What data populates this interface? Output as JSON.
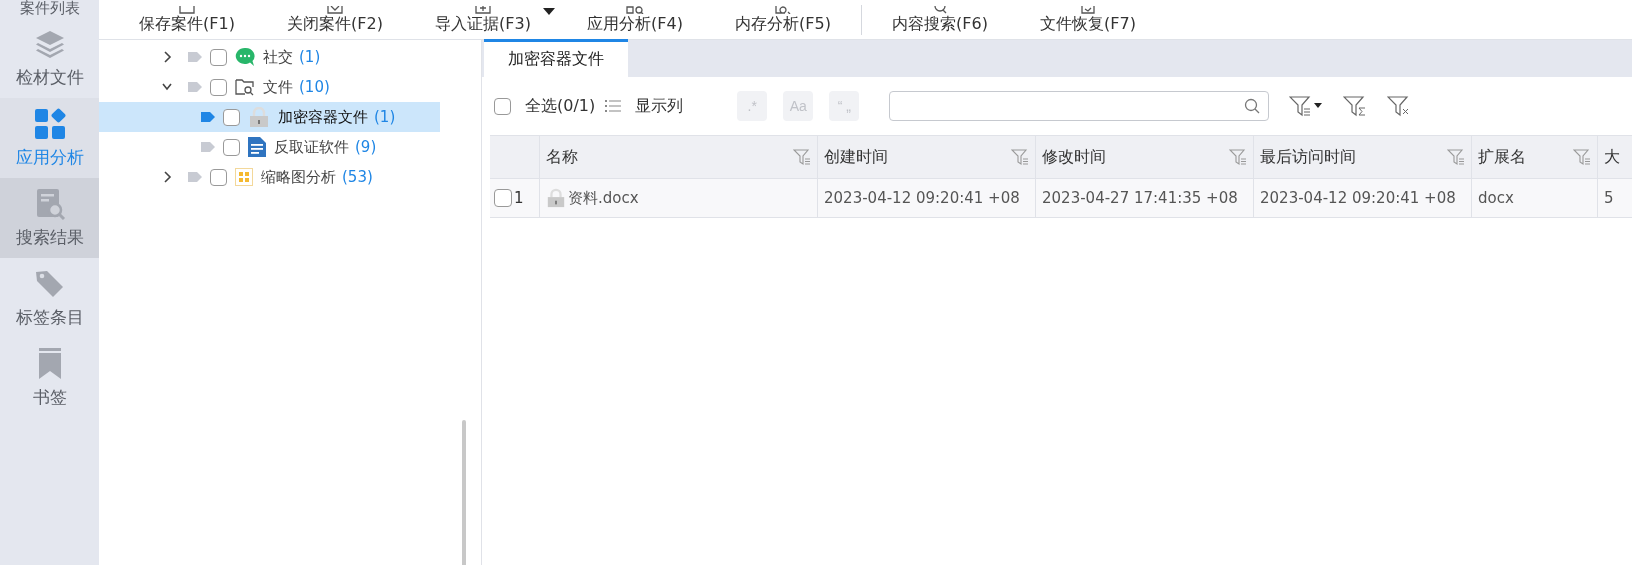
{
  "sidebar": {
    "items": [
      {
        "label": "案件列表",
        "selected": false,
        "hovered": false
      },
      {
        "label": "检材文件",
        "selected": false,
        "hovered": false
      },
      {
        "label": "应用分析",
        "selected": true,
        "hovered": false
      },
      {
        "label": "搜索结果",
        "selected": false,
        "hovered": true
      },
      {
        "label": "标签条目",
        "selected": false,
        "hovered": false
      },
      {
        "label": "书签",
        "selected": false,
        "hovered": false
      }
    ]
  },
  "toolbar": {
    "buttons": [
      {
        "label": "保存案件(F1)",
        "kind": "button"
      },
      {
        "label": "关闭案件(F2)",
        "kind": "button"
      },
      {
        "label": "导入证据(F3)",
        "kind": "button"
      },
      {
        "kind": "dropdown"
      },
      {
        "label": "应用分析(F4)",
        "kind": "button"
      },
      {
        "label": "内存分析(F5)",
        "kind": "button"
      },
      {
        "kind": "separator"
      },
      {
        "label": "内容搜索(F6)",
        "kind": "button"
      },
      {
        "label": "文件恢复(F7)",
        "kind": "button"
      }
    ]
  },
  "tree": [
    {
      "label": "社交",
      "count": "(1)",
      "kind": "chat",
      "expanded": false,
      "checked": false,
      "selected": false
    },
    {
      "label": "文件",
      "count": "(10)",
      "kind": "folder-search",
      "expanded": true,
      "checked": false,
      "selected": false,
      "children": [
        {
          "label": "加密容器文件",
          "count": "(1)",
          "kind": "lock",
          "checked": false,
          "selected": true
        },
        {
          "label": "反取证软件",
          "count": "(9)",
          "kind": "document",
          "checked": false,
          "selected": false
        }
      ]
    },
    {
      "label": "缩略图分析",
      "count": "(53)",
      "kind": "grid",
      "expanded": false,
      "checked": false,
      "selected": false
    }
  ],
  "tabs": [
    {
      "label": "加密容器文件",
      "selected": true
    }
  ],
  "list_toolbar": {
    "select_all": {
      "label": "全选(0/1)",
      "checked": false
    },
    "columns_button": "显示列",
    "regex": ".*",
    "case": "Aa",
    "quote": "“ „"
  },
  "table": {
    "columns": [
      "名称",
      "创建时间",
      "修改时间",
      "最后访问时间",
      "扩展名",
      "大"
    ],
    "rows": [
      {
        "checked": false,
        "number": "1",
        "cells": [
          "资料.docx",
          "2023-04-12 09:20:41 +08",
          "2023-04-27 17:41:35 +08",
          "2023-04-12 09:20:41 +08",
          "docx",
          "5"
        ]
      }
    ]
  }
}
